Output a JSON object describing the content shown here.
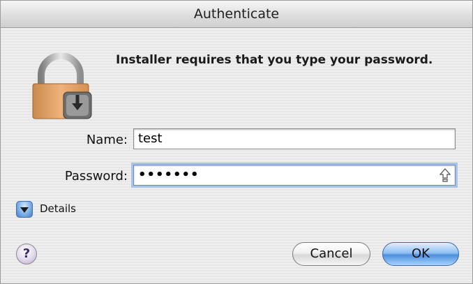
{
  "window": {
    "title": "Authenticate"
  },
  "dialog": {
    "message": "Installer requires that you type your password.",
    "icon": "lock-icon",
    "name_label": "Name:",
    "name_value": "test",
    "password_label": "Password:",
    "password_value": "•••••••",
    "caps_lock_icon": "caps-lock-icon",
    "details_label": "Details",
    "details_icon": "disclosure-triangle-icon",
    "help_label": "?",
    "cancel_label": "Cancel",
    "ok_label": "OK"
  },
  "colors": {
    "default_button": "#5b9be6",
    "focus_ring": "#a9c3e6"
  }
}
